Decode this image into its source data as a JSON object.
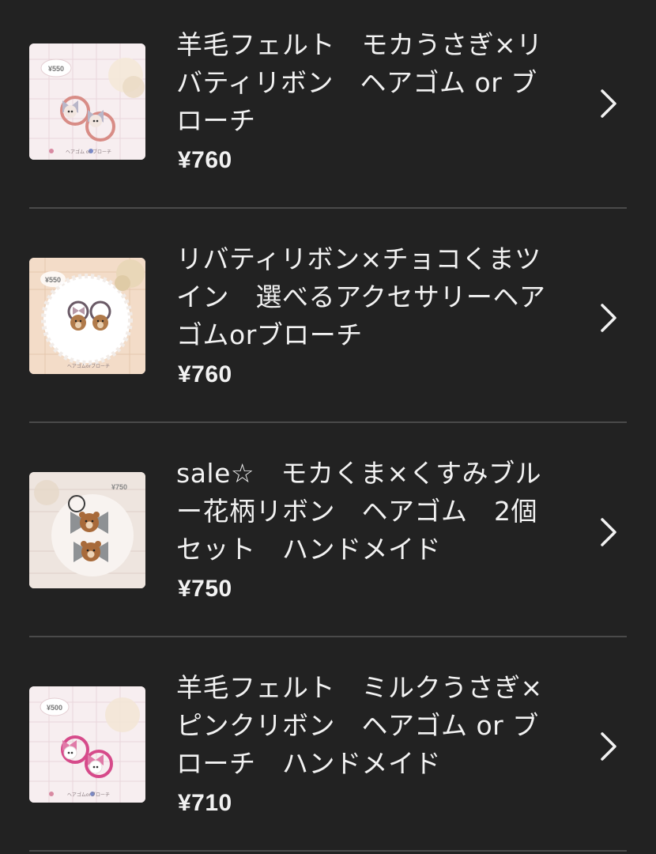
{
  "colors": {
    "background": "#222222",
    "divider": "#4a4a4a",
    "text": "#f2f2f2"
  },
  "items": [
    {
      "title": "羊毛フェルト　モカうさぎ×リバティリボン　ヘアゴム or ブローチ",
      "price": "¥760",
      "thumb_tag": "¥550",
      "thumb_caption": "ヘアゴム or ブローチ",
      "icon": "chevron-right-icon"
    },
    {
      "title": "リバティリボン×チョコくまツイン　選べるアクセサリーヘアゴムorブローチ",
      "price": "¥760",
      "thumb_tag": "¥550",
      "thumb_caption": "ヘアゴムorブローチ",
      "icon": "chevron-right-icon"
    },
    {
      "title": "sale☆　モカくま×くすみブルー花柄リボン　ヘアゴム　2個セット　ハンドメイド",
      "price": "¥750",
      "thumb_tag": "¥750",
      "thumb_caption": "",
      "icon": "chevron-right-icon"
    },
    {
      "title": "羊毛フェルト　ミルクうさぎ×ピンクリボン　ヘアゴム or ブローチ　ハンドメイド",
      "price": "¥710",
      "thumb_tag": "¥500",
      "thumb_caption": "ヘアゴムorブローチ",
      "icon": "chevron-right-icon"
    }
  ]
}
